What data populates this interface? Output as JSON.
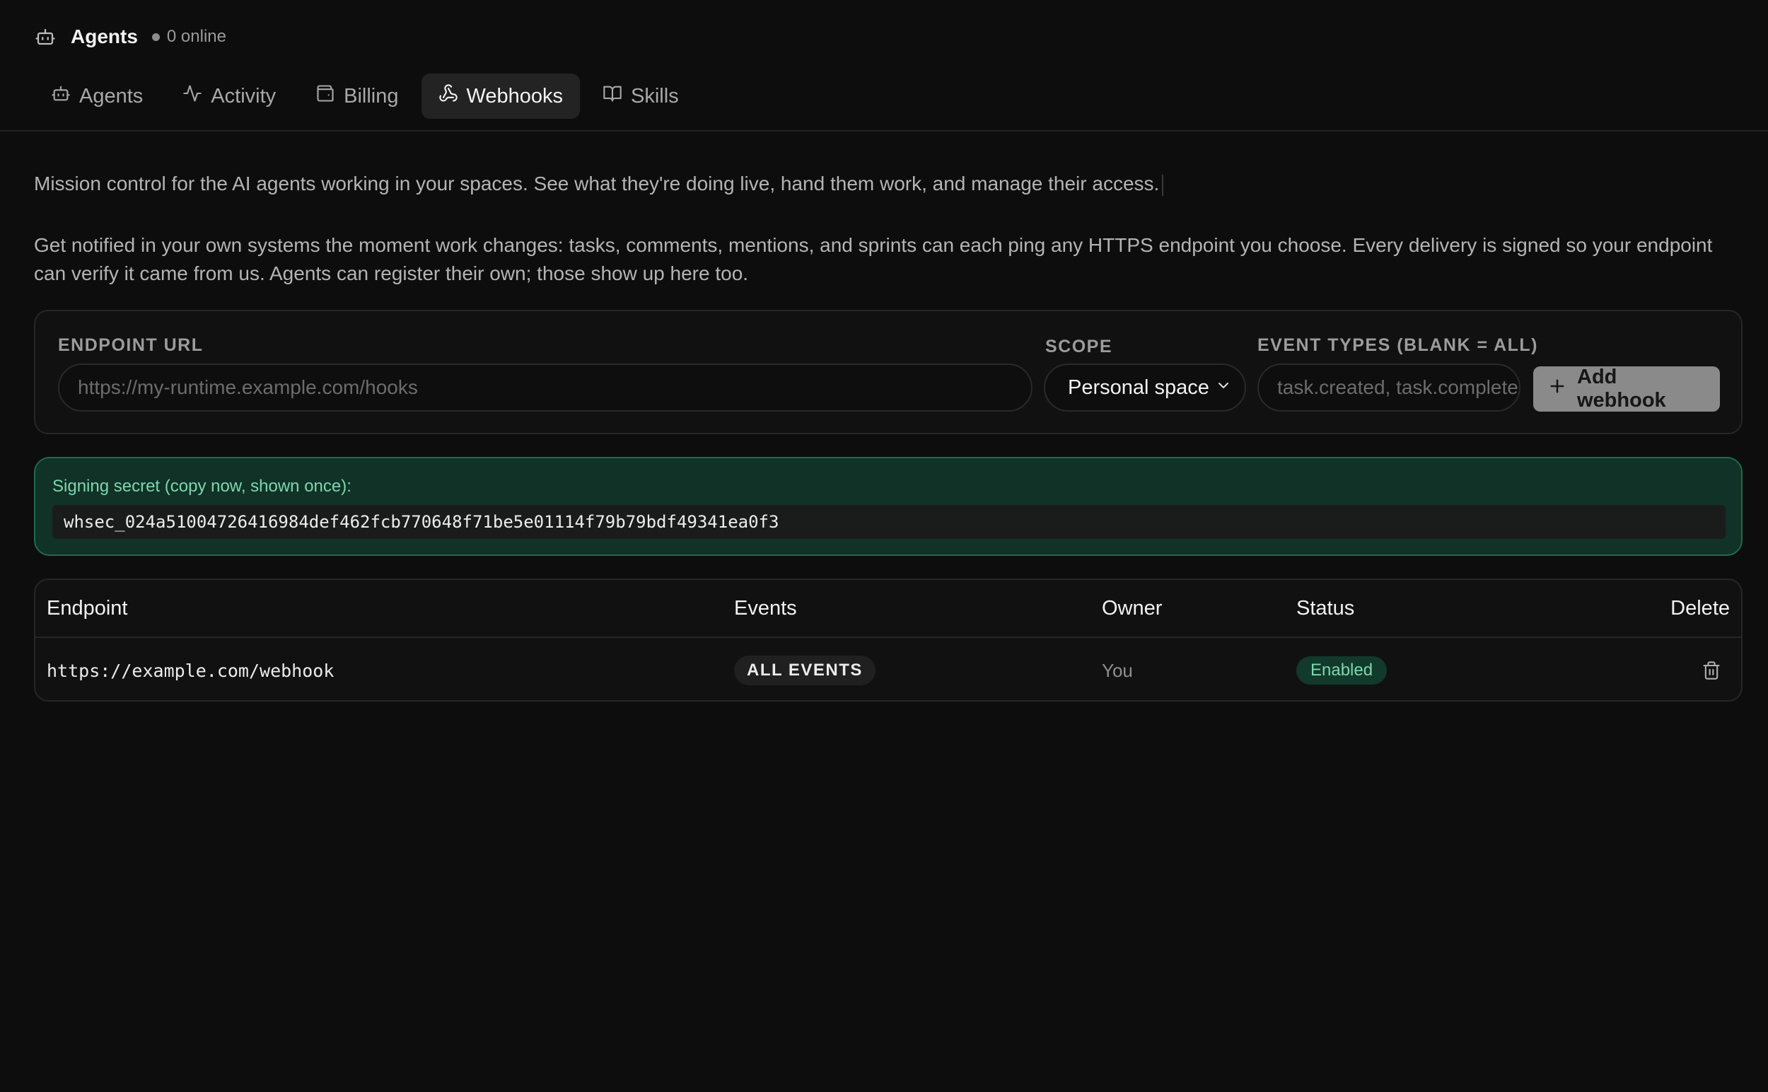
{
  "header": {
    "title": "Agents",
    "online_status": "0 online",
    "icon": "robot-icon"
  },
  "tabs": [
    {
      "label": "Agents",
      "icon": "robot-icon",
      "active": false
    },
    {
      "label": "Activity",
      "icon": "activity-icon",
      "active": false
    },
    {
      "label": "Billing",
      "icon": "wallet-icon",
      "active": false
    },
    {
      "label": "Webhooks",
      "icon": "webhook-icon",
      "active": true
    },
    {
      "label": "Skills",
      "icon": "book-open-icon",
      "active": false
    }
  ],
  "intro_text": "Mission control for the AI agents working in your spaces. See what they're doing live, hand them work, and manage their access.",
  "description": "Get notified in your own systems the moment work changes: tasks, comments, mentions, and sprints can each ping any HTTPS endpoint you choose. Every delivery is signed so your endpoint can verify it came from us. Agents can register their own; those show up here too.",
  "form": {
    "endpoint_label": "ENDPOINT URL",
    "endpoint_placeholder": "https://my-runtime.example.com/hooks",
    "endpoint_value": "",
    "scope_label": "SCOPE",
    "scope_value": "Personal space",
    "events_label": "EVENT TYPES (BLANK = ALL)",
    "events_placeholder": "task.created, task.completed",
    "events_value": "",
    "add_button_label": "Add webhook"
  },
  "secret": {
    "label": "Signing secret (copy now, shown once):",
    "value": "whsec_024a51004726416984def462fcb770648f71be5e01114f79b79bdf49341ea0f3"
  },
  "table": {
    "columns": [
      "Endpoint",
      "Events",
      "Owner",
      "Status",
      "Delete"
    ],
    "rows": [
      {
        "endpoint": "https://example.com/webhook",
        "events": "ALL EVENTS",
        "owner": "You",
        "status": "Enabled"
      }
    ]
  },
  "colors": {
    "background": "#0d0d0d",
    "accent_green": "#7fd6ad",
    "secret_bg": "#103227"
  }
}
